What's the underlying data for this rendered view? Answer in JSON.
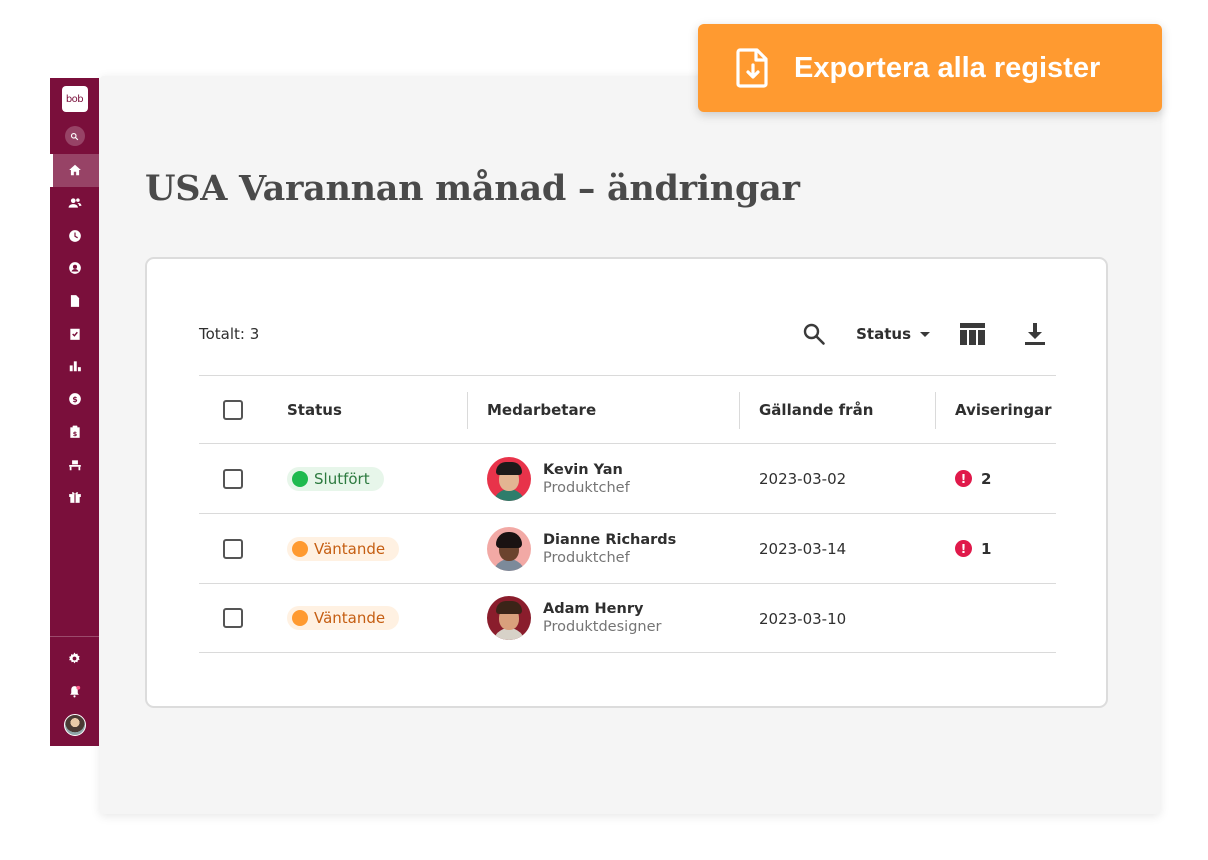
{
  "export_button": {
    "label": "Exportera alla register",
    "color": "#ff9a30"
  },
  "sidebar": {
    "logo": "bob",
    "color": "#7a0f3b",
    "items": [
      {
        "icon": "home-icon",
        "active": true
      },
      {
        "icon": "people-icon"
      },
      {
        "icon": "clock-icon"
      },
      {
        "icon": "profile-icon"
      },
      {
        "icon": "document-icon"
      },
      {
        "icon": "tasks-icon"
      },
      {
        "icon": "analytics-icon"
      },
      {
        "icon": "payroll-icon"
      },
      {
        "icon": "clipboard-icon"
      },
      {
        "icon": "desk-icon"
      },
      {
        "icon": "gift-icon"
      }
    ],
    "bottom_items": [
      {
        "icon": "settings-icon"
      },
      {
        "icon": "notifications-icon"
      },
      {
        "icon": "user-avatar"
      }
    ]
  },
  "page": {
    "title": "USA Varannan månad – ändringar"
  },
  "table": {
    "total_label": "Totalt: 3",
    "status_filter_label": "Status",
    "columns": {
      "status": "Status",
      "employee": "Medarbetare",
      "effective_from": "Gällande från",
      "notifications": "Aviseringar"
    },
    "rows": [
      {
        "status": "Slutfört",
        "status_type": "done",
        "name": "Kevin Yan",
        "role": "Produktchef",
        "date": "2023-03-02",
        "notifications": "2"
      },
      {
        "status": "Väntande",
        "status_type": "pending",
        "name": "Dianne Richards",
        "role": "Produktchef",
        "date": "2023-03-14",
        "notifications": "1"
      },
      {
        "status": "Väntande",
        "status_type": "pending",
        "name": "Adam Henry",
        "role": "Produktdesigner",
        "date": "2023-03-10",
        "notifications": ""
      }
    ]
  }
}
